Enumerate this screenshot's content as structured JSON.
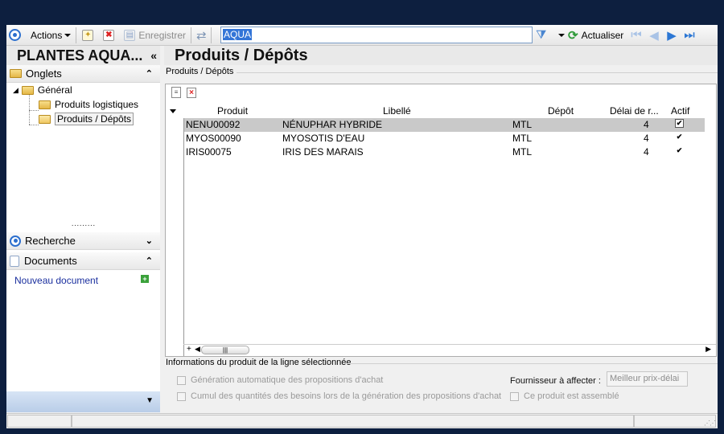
{
  "toolbar": {
    "actions_label": "Actions",
    "save_label": "Enregistrer",
    "search_value": "AQUA",
    "refresh_label": "Actualiser"
  },
  "left_panel": {
    "title": "PLANTES AQUA...",
    "collapse_glyph": "«",
    "onglets_label": "Onglets",
    "tree": {
      "root": "Général",
      "children": [
        "Produits logistiques",
        "Produits / Dépôts"
      ]
    },
    "recherche_label": "Recherche",
    "documents_label": "Documents",
    "new_document_label": "Nouveau document"
  },
  "main": {
    "title": "Produits / Dépôts",
    "group_label": "Produits / Dépôts",
    "columns": [
      "Produit",
      "Libellé",
      "Dépôt",
      "Délai de r...",
      "Actif"
    ],
    "rows": [
      {
        "produit": "NENU00092",
        "libelle": "NÉNUPHAR HYBRIDE",
        "depot": "MTL",
        "delai": "4",
        "actif": "✔"
      },
      {
        "produit": "MYOS00090",
        "libelle": "MYOSOTIS D'EAU",
        "depot": "MTL",
        "delai": "4",
        "actif": "✔"
      },
      {
        "produit": "IRIS00075",
        "libelle": "IRIS DES MARAIS",
        "depot": "MTL",
        "delai": "4",
        "actif": "✔"
      }
    ],
    "info_label": "Informations du produit de la ligne sélectionnée",
    "option_1": "Génération automatique des propositions d'achat",
    "option_2": "Cumul des quantités des besoins lors de la génération des propositions d'achat",
    "supplier_label": "Fournisseur à affecter :",
    "supplier_value": "Meilleur prix-délai",
    "assembled_label": "Ce produit est assemblé"
  },
  "colors": {
    "background": "#0d1f3f",
    "accent": "#2c77d4",
    "selection": "#3375d7",
    "selected_row": "#c9c9c9"
  },
  "icons": [
    "app-menu-icon",
    "new-icon",
    "delete-icon",
    "save-icon",
    "sync-icon",
    "filter-icon",
    "refresh-icon",
    "first-icon",
    "prev-icon",
    "next-icon",
    "last-icon"
  ]
}
